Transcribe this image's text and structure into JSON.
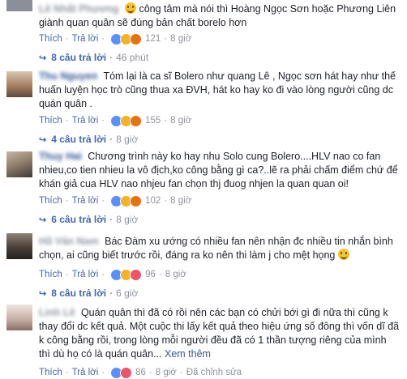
{
  "comments": [
    {
      "name": "Lê Nhất Phương",
      "text": "công tâm mà nói thì Hoàng Ngọc Sơn hoặc Phương Liên giành quan quân sẽ đúng bản chất borelo hơn",
      "has_emoji": true,
      "like": "Thích",
      "reply": "Trả lời",
      "reaction_count": "121",
      "time": "8 giờ",
      "replies_label": "8 câu trả lời",
      "replies_time": "46 phút"
    },
    {
      "name": "Thu Nguyen",
      "text": "Tóm lại là ca sĩ Bolero như quang Lê , Ngọc sơn hát hay như thế huấn luyện học trò cũng thua xa ĐVH, hát ko hay ko đi vào lòng người cũng dc quán quân .",
      "like": "Thích",
      "reply": "Trả lời",
      "reaction_count": "155",
      "time": "8 giờ",
      "replies_label": "4 câu trả lời",
      "replies_time": "8 giờ"
    },
    {
      "name": "Thuy Hai",
      "text": "Chương trình này ko hay nhu Solo cung Bolero....HLV nao co fan nhieu,co tien nhieu la vô địch,ko công bằng gì ca?..lẽ ra phải chấm điểm chứ để khán giả cua HLV nao nhjeu fan chọn thj đuog nhjen la quan quan oi!",
      "like": "Thích",
      "reply": "Trả lời",
      "reaction_count": "102",
      "time": "8 giờ",
      "replies_label": "6 câu trả lời",
      "replies_time": "8 giờ"
    },
    {
      "name": "Hồ Văn Nam",
      "text": "Bác Đàm xu ướng có nhiều fan nên nhận đc nhiều tin nhắn bình chọn, ai cũng biết trước rồi, đáng ra ko nên thi làm j cho mệt họng",
      "has_emoji": true,
      "like": "Thích",
      "reply": "Trả lời",
      "reaction_count": "96",
      "time": "8 giờ",
      "replies_label": "8 câu trả lời",
      "replies_time": "6 giờ"
    },
    {
      "name": "Linh Lê",
      "text": "Quán quân thì đã có rồi nên các bạn có chửi bới gì đi nữa thì cũng k thay đổi dc kết quả. Một cuộc thi lấy kết quả theo hiệu ứng số đông thì vốn dĩ đã k công bằng rồi, trong lòng mỗi người đều đã có 1 thần tượng riêng của mình thì dù họ có là quán quân...",
      "see_more": "Xem thêm",
      "like": "Thích",
      "reply": "Trả lời",
      "reaction_count": "86",
      "time": "8 giờ",
      "edited": "Đã chỉnh sửa"
    }
  ],
  "colors": {
    "link": "#4267b2",
    "name": "#365899",
    "meta": "#90949c"
  }
}
